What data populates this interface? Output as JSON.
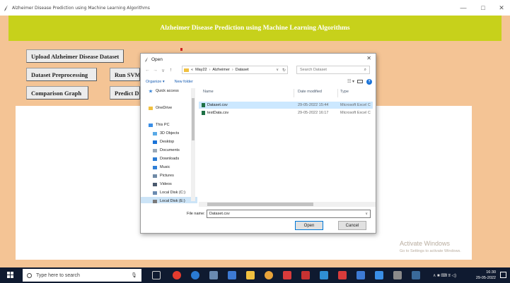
{
  "window": {
    "title": "Alzheimer Disease Prediction using Machine Learning Algorithms",
    "min_label": "—",
    "max_label": "□",
    "close_label": "✕"
  },
  "banner": {
    "text": "Alzheimer Disease Prediction using Machine Learning Algorithms"
  },
  "buttons": {
    "upload": "Upload Alzheimer Disease Dataset",
    "preprocess": "Dataset Preprocessing",
    "run_svm": "Run SVM",
    "comparison": "Comparison Graph",
    "predict": "Predict D"
  },
  "watermark": {
    "line1": "Activate Windows",
    "line2": "Go to Settings to activate Windows."
  },
  "dialog": {
    "title": "Open",
    "close": "✕",
    "nav": {
      "back": "←",
      "forward": "→",
      "recent": "∨",
      "up": "↑"
    },
    "address": {
      "prefix": "«",
      "crumbs": [
        "May22",
        "Alzheimer",
        "Dataset"
      ],
      "separator": "›",
      "dropdown": "∨",
      "refresh": "↻"
    },
    "search": {
      "placeholder": "Search Dataset",
      "icon": "⌕"
    },
    "organize": "Organize ▾",
    "new_folder": "New folder",
    "help": "?",
    "view_icons": "☷ ▾",
    "sidebar": [
      {
        "label": "Quick access",
        "icon": "star-icon",
        "color": "#2f7fd6"
      },
      {
        "label": "",
        "icon": "",
        "color": ""
      },
      {
        "label": "OneDrive",
        "icon": "cloud-icon",
        "color": "#f0c040"
      },
      {
        "label": "",
        "icon": "",
        "color": ""
      },
      {
        "label": "This PC",
        "icon": "computer-icon",
        "color": "#3a8ee6"
      },
      {
        "label": "3D Objects",
        "icon": "cube-icon",
        "color": "#5aa9e6"
      },
      {
        "label": "Desktop",
        "icon": "desktop-icon",
        "color": "#1a73d8"
      },
      {
        "label": "Documents",
        "icon": "document-icon",
        "color": "#9aa8b8"
      },
      {
        "label": "Downloads",
        "icon": "download-icon",
        "color": "#2a7bd4"
      },
      {
        "label": "Music",
        "icon": "music-icon",
        "color": "#2f7fd6"
      },
      {
        "label": "Pictures",
        "icon": "picture-icon",
        "color": "#6f8aa6"
      },
      {
        "label": "Videos",
        "icon": "video-icon",
        "color": "#4a5a6e"
      },
      {
        "label": "Local Disk (C:)",
        "icon": "disk-icon",
        "color": "#6a8ab0"
      },
      {
        "label": "Local Disk (E:)",
        "icon": "disk-icon",
        "color": "#7a7a7a"
      }
    ],
    "columns": {
      "name": "Name",
      "date": "Date modified",
      "type": "Type"
    },
    "files": [
      {
        "name": "Dataset.csv",
        "date": "29-05-2022 15:44",
        "type": "Microsoft Excel C",
        "selected": true
      },
      {
        "name": "testData.csv",
        "date": "29-05-2022 16:17",
        "type": "Microsoft Excel C",
        "selected": false
      }
    ],
    "scroll": {
      "left": "<",
      "right": ">",
      "up": "^",
      "down": "v"
    },
    "filename_label": "File name:",
    "filename_value": "Dataset.csv",
    "filename_dropdown": "∨",
    "open_label": "Open",
    "cancel_label": "Cancel"
  },
  "taskbar": {
    "search_placeholder": "Type here to search",
    "mic": "🎙",
    "tray": "∧ ■ ⌨ ड ◁)",
    "time": "16:30",
    "date": "29-05-2022"
  }
}
